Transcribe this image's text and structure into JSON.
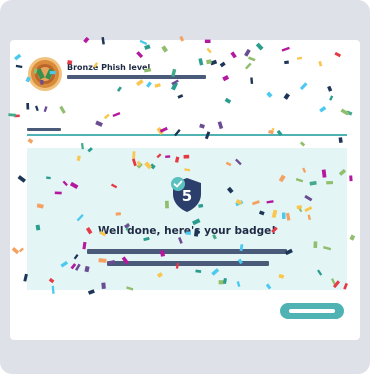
{
  "header": {
    "level_label": "Bronze Phish level"
  },
  "badge": {
    "count": "5",
    "title": "Well done, here's your badge!"
  },
  "colors": {
    "accent": "#4fb3b3",
    "text_dark": "#1f2a44",
    "placeholder_bar": "#4a5b7a",
    "panel_bg": "#e4f5f5",
    "medal_bronze": "#d98a3a",
    "shield_navy": "#2c3e6b"
  },
  "icons": {
    "medal": "bronze-medal-icon",
    "shield": "shield-badge-icon",
    "check": "check-icon"
  }
}
